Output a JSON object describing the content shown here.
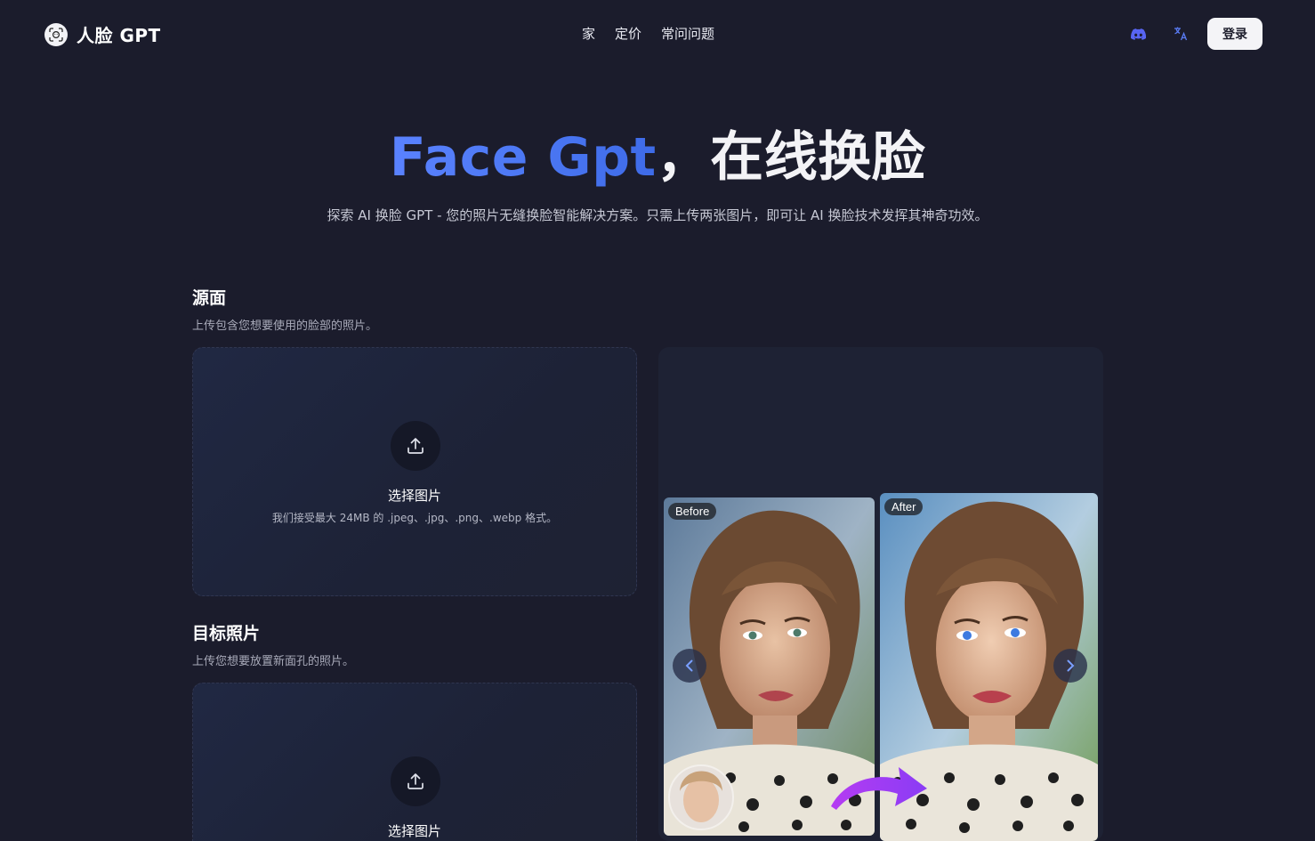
{
  "header": {
    "logo_text": "人脸 GPT",
    "nav": [
      {
        "label": "家"
      },
      {
        "label": "定价"
      },
      {
        "label": "常问问题"
      }
    ],
    "login_label": "登录"
  },
  "hero": {
    "brand": "Face Gpt",
    "separator": "，",
    "tagline": "在线换脸",
    "subtitle": "探索 AI 换脸 GPT - 您的照片无缝换脸智能解决方案。只需上传两张图片，即可让 AI 换脸技术发挥其神奇功效。"
  },
  "source": {
    "title": "源面",
    "description": "上传包含您想要使用的脸部的照片。",
    "upload_label": "选择图片",
    "upload_hint": "我们接受最大 24MB 的 .jpeg、.jpg、.png、.webp 格式。"
  },
  "target": {
    "title": "目标照片",
    "description": "上传您想要放置新面孔的照片。",
    "upload_label": "选择图片"
  },
  "preview": {
    "before_label": "Before",
    "after_label": "After"
  },
  "colors": {
    "background": "#1b1c2c",
    "accent": "#4b77f3",
    "discord": "#5865f2"
  }
}
